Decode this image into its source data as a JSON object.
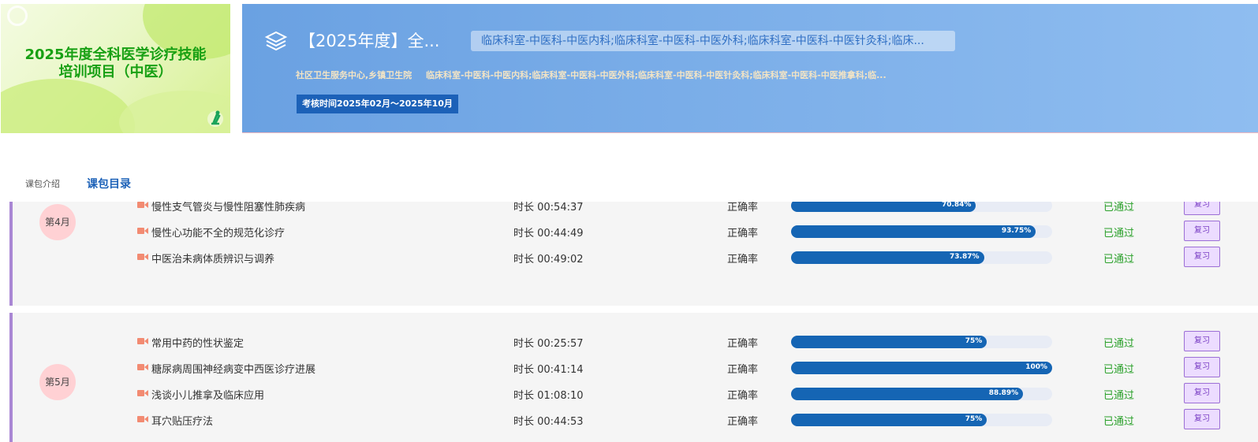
{
  "cover": {
    "title_line1": "2025年度全科医学诊疗技能",
    "title_line2": "培训项目（中医）"
  },
  "banner": {
    "title": "【2025年度】全...",
    "departments": "临床科室-中医科-中医内科;临床科室-中医科-中医外科;临床科室-中医科-中医针灸科;临床...",
    "institutions": "社区卫生服务中心,乡镇卫生院",
    "departments_full": "临床科室-中医科-中医内科;临床科室-中医科-中医外科;临床科室-中医科-中医针灸科;临床科室-中医科-中医推拿科;临...",
    "exam_time": "考核时间2025年02月～2025年10月",
    "icon": "layers-icon"
  },
  "tabs": {
    "intro": "课包介绍",
    "catalog": "课包目录",
    "active": "catalog"
  },
  "labels": {
    "accuracy": "正确率",
    "review": "复习"
  },
  "colors": {
    "progress": "#1565b4",
    "passed": "#2aa02a",
    "accent": "#a987d4",
    "badge": "#ffd1d4"
  },
  "months": [
    {
      "label": "第4月",
      "lessons": [
        {
          "title": "慢性支气管炎与慢性阻塞性肺疾病",
          "duration": "时长 00:54:37",
          "accuracy": 70.84,
          "accuracy_text": "70.84%",
          "status": "已通过"
        },
        {
          "title": "慢性心功能不全的规范化诊疗",
          "duration": "时长 00:44:49",
          "accuracy": 93.75,
          "accuracy_text": "93.75%",
          "status": "已通过"
        },
        {
          "title": "中医治未病体质辨识与调养",
          "duration": "时长 00:49:02",
          "accuracy": 73.87,
          "accuracy_text": "73.87%",
          "status": "已通过"
        }
      ]
    },
    {
      "label": "第5月",
      "lessons": [
        {
          "title": "常用中药的性状鉴定",
          "duration": "时长 00:25:57",
          "accuracy": 75,
          "accuracy_text": "75%",
          "status": "已通过"
        },
        {
          "title": "糖尿病周围神经病变中西医诊疗进展",
          "duration": "时长 00:41:14",
          "accuracy": 100,
          "accuracy_text": "100%",
          "status": "已通过"
        },
        {
          "title": "浅谈小儿推拿及临床应用",
          "duration": "时长 01:08:10",
          "accuracy": 88.89,
          "accuracy_text": "88.89%",
          "status": "已通过"
        },
        {
          "title": "耳穴贴压疗法",
          "duration": "时长 00:44:53",
          "accuracy": 75,
          "accuracy_text": "75%",
          "status": "已通过"
        }
      ]
    }
  ]
}
